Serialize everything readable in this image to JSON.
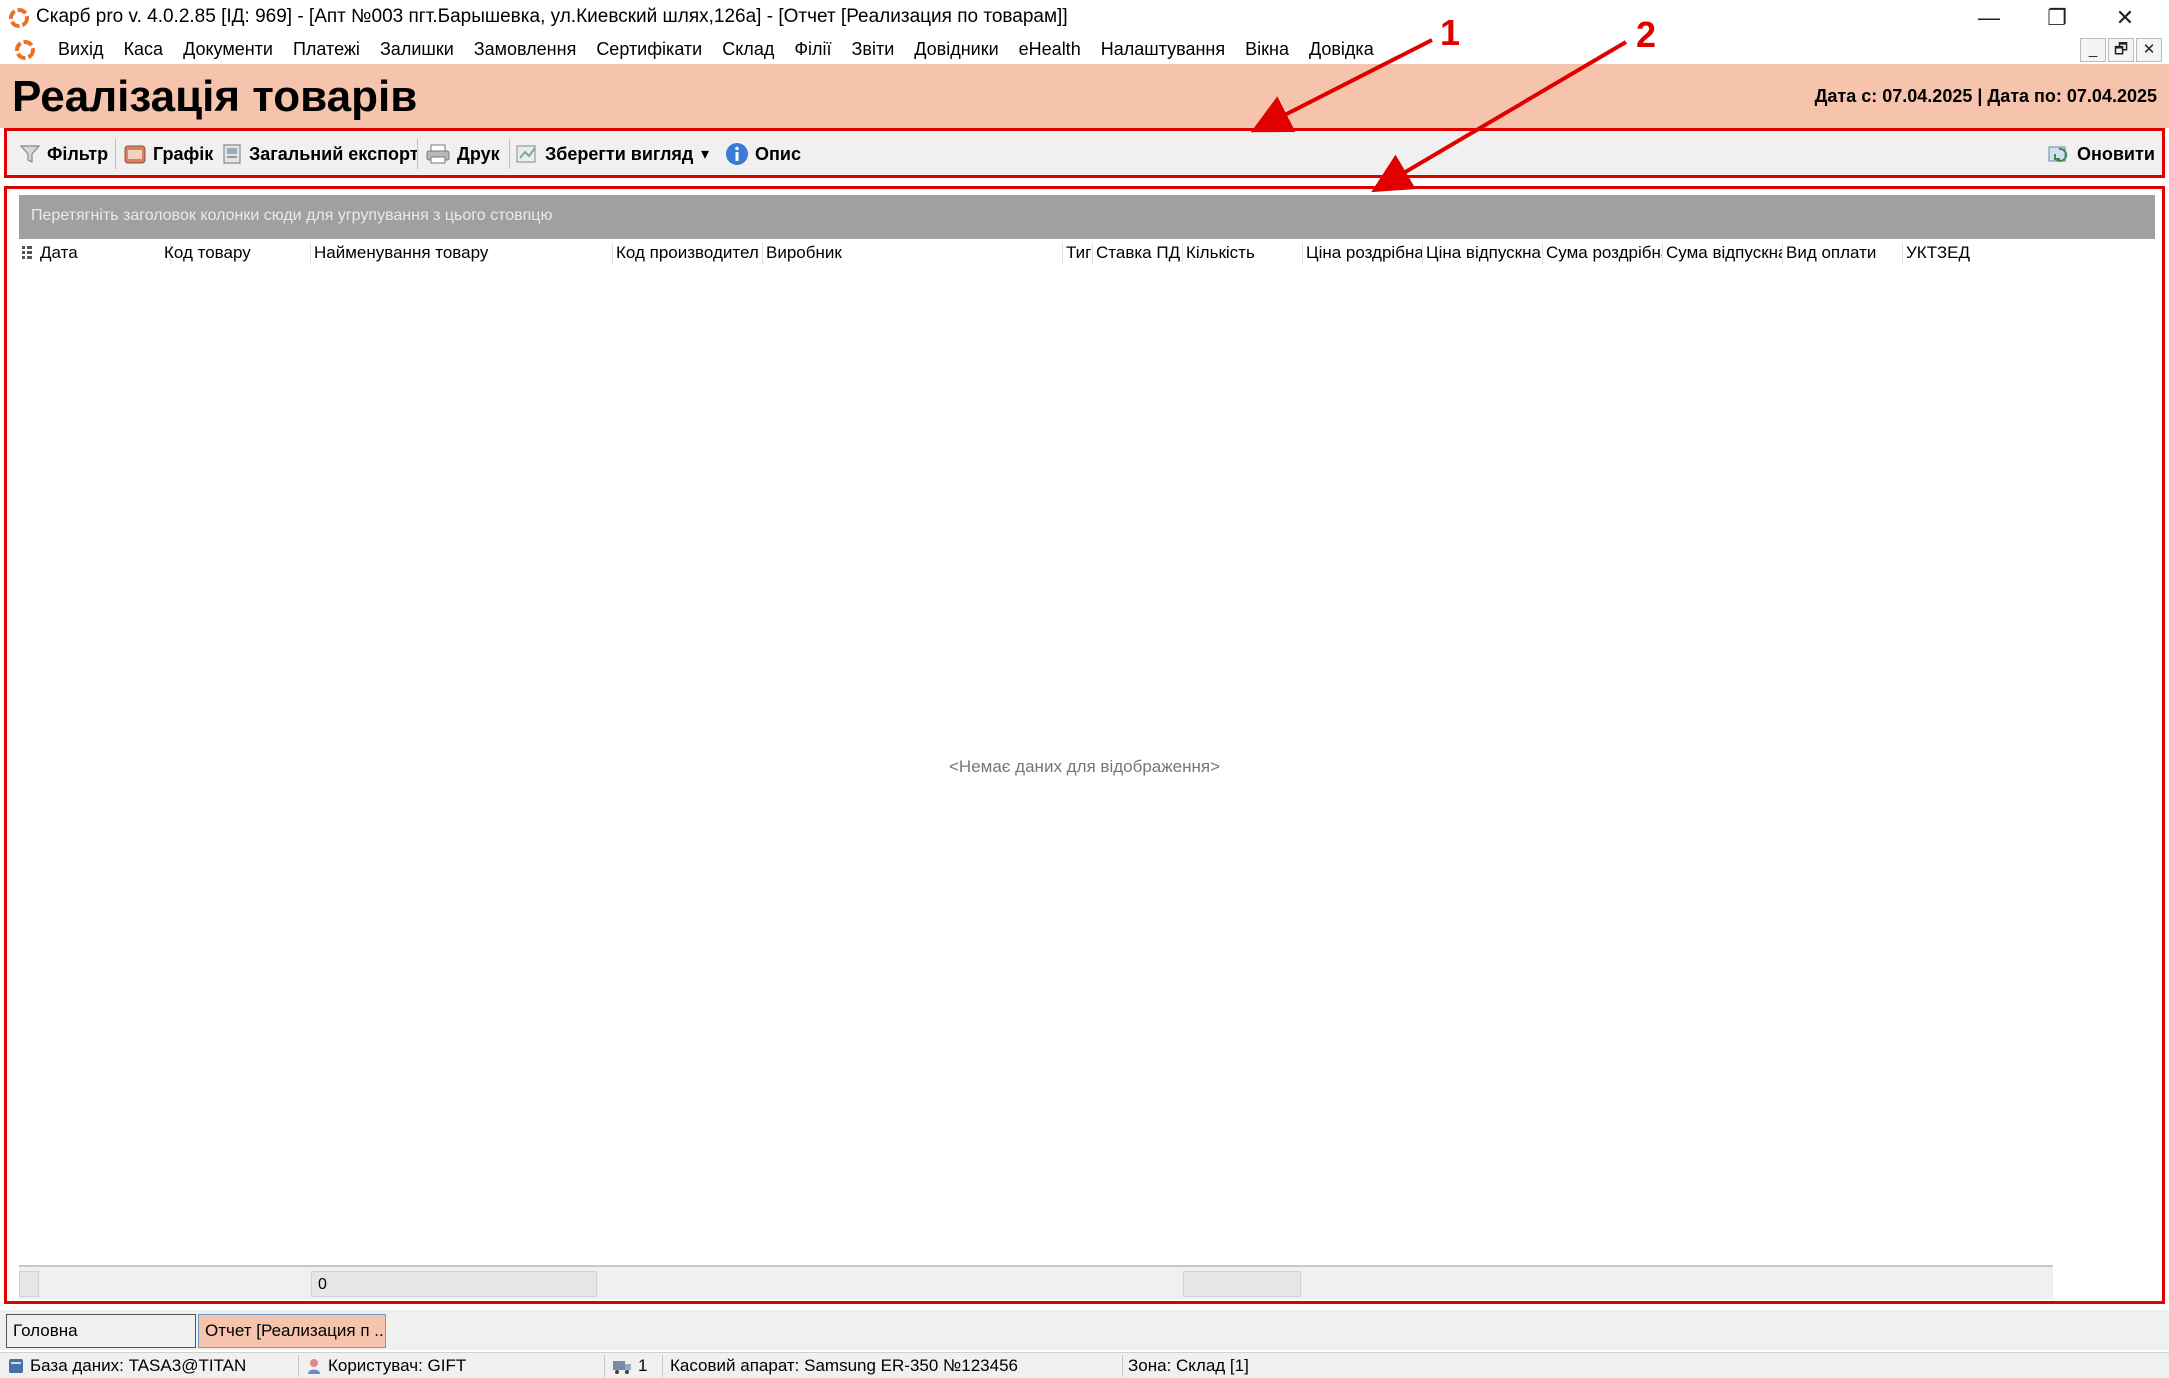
{
  "window": {
    "title": "Скарб pro v. 4.0.2.85 [ІД: 969] - [Апт №003 пгт.Барышевка, ул.Киевский шлях,126а] - [Отчет [Реализация по товарам]]",
    "minimize": "—",
    "maximize": "❐",
    "close": "✕"
  },
  "menu": {
    "items": [
      "Вихід",
      "Каса",
      "Документи",
      "Платежі",
      "Залишки",
      "Замовлення",
      "Сертифікати",
      "Склад",
      "Філії",
      "Звіти",
      "Довідники",
      "eHealth",
      "Налаштування",
      "Вікна",
      "Довідка"
    ],
    "mdi_minimize": "_",
    "mdi_restore": "🗗",
    "mdi_close": "✕"
  },
  "header": {
    "title": "Реалізація товарів",
    "date_range": "Дата с: 07.04.2025 | Дата по: 07.04.2025"
  },
  "toolbar": {
    "filter": "Фільтр",
    "chart": "Графік",
    "export": "Загальний експорт",
    "print": "Друк",
    "save_view": "Зберегти вигляд",
    "dropdown": "▾",
    "description": "Опис",
    "refresh": "Оновити"
  },
  "grid": {
    "group_panel": "Перетягніть заголовок колонки сюди для угрупування з цього стовпцю",
    "columns": [
      "Дата",
      "Код товару",
      "Найменування товару",
      "Код производител",
      "Виробник",
      "Тиг",
      "Ставка ПД",
      "Кількість",
      "Ціна роздрібна",
      "Ціна відпускна",
      "Сума роздрібна",
      "Сума відпускна",
      "Вид оплати",
      "УКТЗЕД"
    ],
    "empty_message": "<Немає даних для відображення>",
    "footer_value": "0"
  },
  "tabs": {
    "main": "Головна",
    "report": "Отчет [Реализация п ..."
  },
  "status": {
    "database": "База даних: TASA3@TITAN",
    "user": "Користувач: GIFT",
    "count": "1",
    "cash_register": "Касовий апарат: Samsung ER-350 №123456",
    "zone": "Зона: Склад [1]"
  },
  "annotations": {
    "label1": "1",
    "label2": "2"
  },
  "colors": {
    "header_bg": "#f6c4ac",
    "annotation_red": "#e00000",
    "group_panel_bg": "#a0a0a0",
    "active_tab_bg": "#f6c4ac"
  }
}
